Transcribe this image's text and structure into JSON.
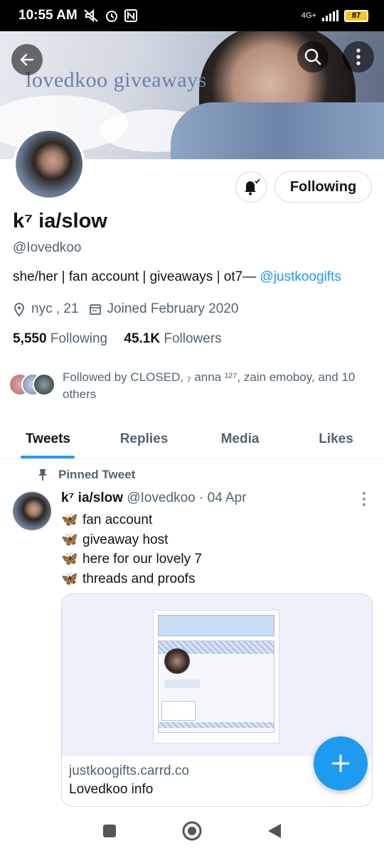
{
  "status_bar": {
    "time": "10:55 AM",
    "network": "4G+",
    "battery": "87",
    "icons": [
      "mute-icon",
      "alarm-icon",
      "nfc-icon",
      "signal-icon",
      "battery-icon"
    ]
  },
  "banner": {
    "text": "lovedkoo giveaways",
    "back_icon": "arrow-left-icon",
    "search_icon": "search-icon",
    "more_icon": "more-vertical-icon"
  },
  "profile": {
    "name": "k⁷ ia/slow",
    "handle": "@Iovedkoo",
    "bio_text": "she/her | fan account | giveaways | ot7— ",
    "bio_link": "@justkoogifts",
    "location": "nyc , 21",
    "joined": "Joined February 2020",
    "following_count": "5,550",
    "following_label": "Following",
    "followers_count": "45.1K",
    "followers_label": "Followers",
    "followed_by": "Followed by CLOSED, ₇ anna ¹²⁷, zain emoboy, and 10 others",
    "follow_button": "Following"
  },
  "tabs": [
    {
      "label": "Tweets",
      "active": true
    },
    {
      "label": "Replies",
      "active": false
    },
    {
      "label": "Media",
      "active": false
    },
    {
      "label": "Likes",
      "active": false
    }
  ],
  "tweet": {
    "pinned_label": "Pinned Tweet",
    "author_name": "k⁷ ia/slow",
    "author_handle": "@Iovedkoo",
    "separator": "·",
    "date": "04 Apr",
    "lines": [
      "fan account",
      "giveaway host",
      "here for our lovely 7",
      "threads and proofs"
    ],
    "card": {
      "domain": "justkoogifts.carrd.co",
      "title": "Lovedkoo info"
    }
  },
  "colors": {
    "accent": "#1d9bf0",
    "muted": "#536471",
    "text": "#0f1419"
  }
}
